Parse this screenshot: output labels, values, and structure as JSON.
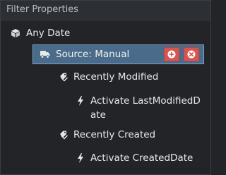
{
  "panel": {
    "title": "Filter Properties"
  },
  "tree": {
    "root": {
      "label": "Any Date",
      "icon": "cube-icon"
    },
    "source": {
      "label": "Source: Manual",
      "icon": "truck-icon",
      "add_button_icon": "plus-circle-icon",
      "remove_button_icon": "times-circle-icon",
      "selected_bg": "#4a6c8a",
      "button_color": "#d9534f"
    },
    "groups": [
      {
        "label": "Recently Modified",
        "icon": "tags-icon",
        "actions": [
          {
            "label": "Activate LastModifiedDate",
            "icon": "bolt-icon"
          }
        ]
      },
      {
        "label": "Recently Created",
        "icon": "tags-icon",
        "actions": [
          {
            "label": "Activate CreatedDate",
            "icon": "bolt-icon"
          }
        ]
      }
    ]
  }
}
